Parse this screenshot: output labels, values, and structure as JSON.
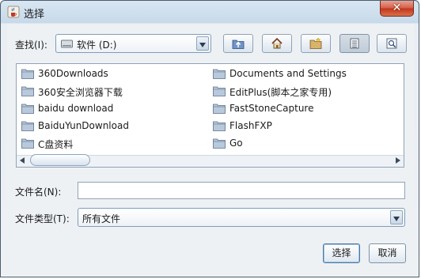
{
  "window": {
    "title": "选择",
    "close_symbol": "✕"
  },
  "lookin": {
    "label": "查找(I):",
    "value": "软件 (D:)"
  },
  "toolbar": {
    "up_icon": "up-folder-icon",
    "home_icon": "home-icon",
    "new_folder_icon": "new-folder-icon",
    "list_icon": "list-view-icon",
    "details_icon": "details-view-icon"
  },
  "files": {
    "left": [
      "360Downloads",
      "360安全浏览器下载",
      "baidu download",
      "BaiduYunDownload",
      "C盘资料"
    ],
    "right": [
      "Documents and Settings",
      "EditPlus(脚本之家专用)",
      "FastStoneCapture",
      "FlashFXP",
      "Go"
    ]
  },
  "filename": {
    "label": "文件名(N):",
    "value": ""
  },
  "filetype": {
    "label": "文件类型(T):",
    "value": "所有文件"
  },
  "buttons": {
    "select": "选择",
    "cancel": "取消"
  }
}
